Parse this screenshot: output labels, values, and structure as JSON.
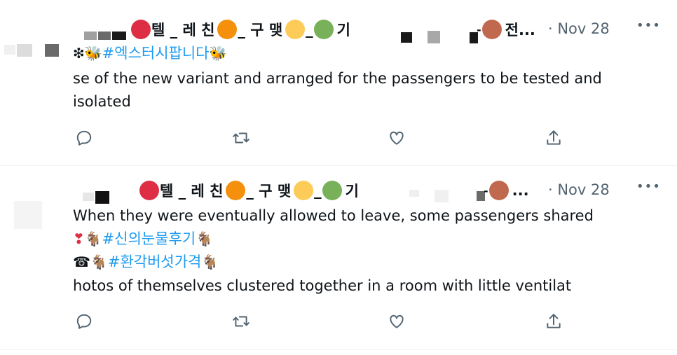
{
  "tweets": [
    {
      "name_parts": [
        "텔 _ 레 친",
        " _ 구 맺",
        " _ ",
        "기"
      ],
      "name_suffix": "-",
      "name_tail": "전...",
      "dot_colors": [
        "#dd2e44",
        "#f4900c",
        "#fdcb58",
        "#78b159",
        "#c1694f"
      ],
      "date": "· Nov 28",
      "more": "•••",
      "lines": [
        {
          "prefix": "❇🐝",
          "hashtag": "#엑스터시팝니다",
          "suffix": "🐝"
        },
        {
          "text": "se of the new variant and arranged for the passengers to be tested and"
        },
        {
          "text": "isolated"
        }
      ]
    },
    {
      "name_parts": [
        "텔 _ 레 친",
        " _ 구 맺",
        " _ ",
        "기"
      ],
      "name_suffix": "-",
      "name_tail": "...",
      "dot_colors": [
        "#dd2e44",
        "#f4900c",
        "#fdcb58",
        "#78b159",
        "#c1694f"
      ],
      "date": "· Nov 28",
      "more": "•••",
      "lines": [
        {
          "text": "When they were eventually allowed to leave, some passengers shared"
        },
        {
          "prefix": "❣🐐",
          "hashtag": "#신의눈물후기",
          "suffix": "🐐"
        },
        {
          "prefix": "☎🐐",
          "hashtag": "#환각버섯가격",
          "suffix": "🐐"
        },
        {
          "text": "hotos of themselves clustered together in a room with little ventilat"
        }
      ]
    }
  ],
  "actions": [
    "reply-icon",
    "retweet-icon",
    "like-icon",
    "share-icon"
  ],
  "colors": {
    "text": "#0f1419",
    "muted": "#536471",
    "link": "#1d9bf0",
    "divider": "#eff3f4"
  }
}
